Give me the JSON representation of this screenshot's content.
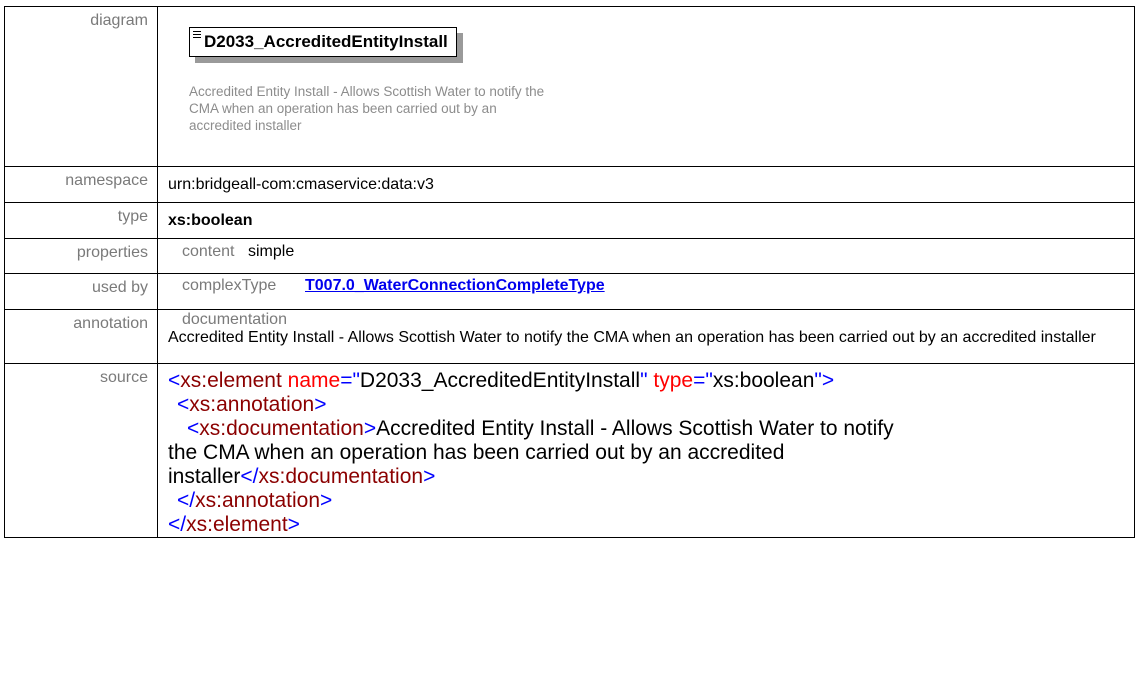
{
  "rows": {
    "diagram": {
      "label": "diagram",
      "element_name": "D2033_AccreditedEntityInstall",
      "description": "Accredited Entity Install - Allows Scottish Water to notify the CMA when an operation has been carried out by an accredited installer"
    },
    "namespace": {
      "label": "namespace",
      "value": "urn:bridgeall-com:cmaservice:data:v3"
    },
    "type": {
      "label": "type",
      "value": "xs:boolean"
    },
    "properties": {
      "label": "properties",
      "key": "content",
      "value": "simple"
    },
    "used_by": {
      "label": "used by",
      "kind": "complexType",
      "link": "T007.0_WaterConnectionCompleteType"
    },
    "annotation": {
      "label": "annotation",
      "heading": "documentation",
      "text": "Accredited Entity Install - Allows Scottish Water to notify the CMA when an operation has been carried out by an accredited installer"
    },
    "source": {
      "label": "source",
      "tag_element": "xs:element",
      "attr_name": "name",
      "attr_name_value": "D2033_AccreditedEntityInstall",
      "attr_type": "type",
      "attr_type_value": "xs:boolean",
      "tag_annotation": "xs:annotation",
      "tag_documentation": "xs:documentation",
      "doc_text_line1": "Accredited Entity Install - Allows Scottish Water to notify",
      "doc_text_line2": "the CMA when an operation has been carried out by an accredited",
      "doc_text_line3": "installer"
    }
  },
  "colors": {
    "label_gray": "#7a7a7a",
    "xml_tag": "#8b0000",
    "xml_bracket": "#0000ff",
    "xml_attr": "#ff0000",
    "link": "#0000ee"
  }
}
